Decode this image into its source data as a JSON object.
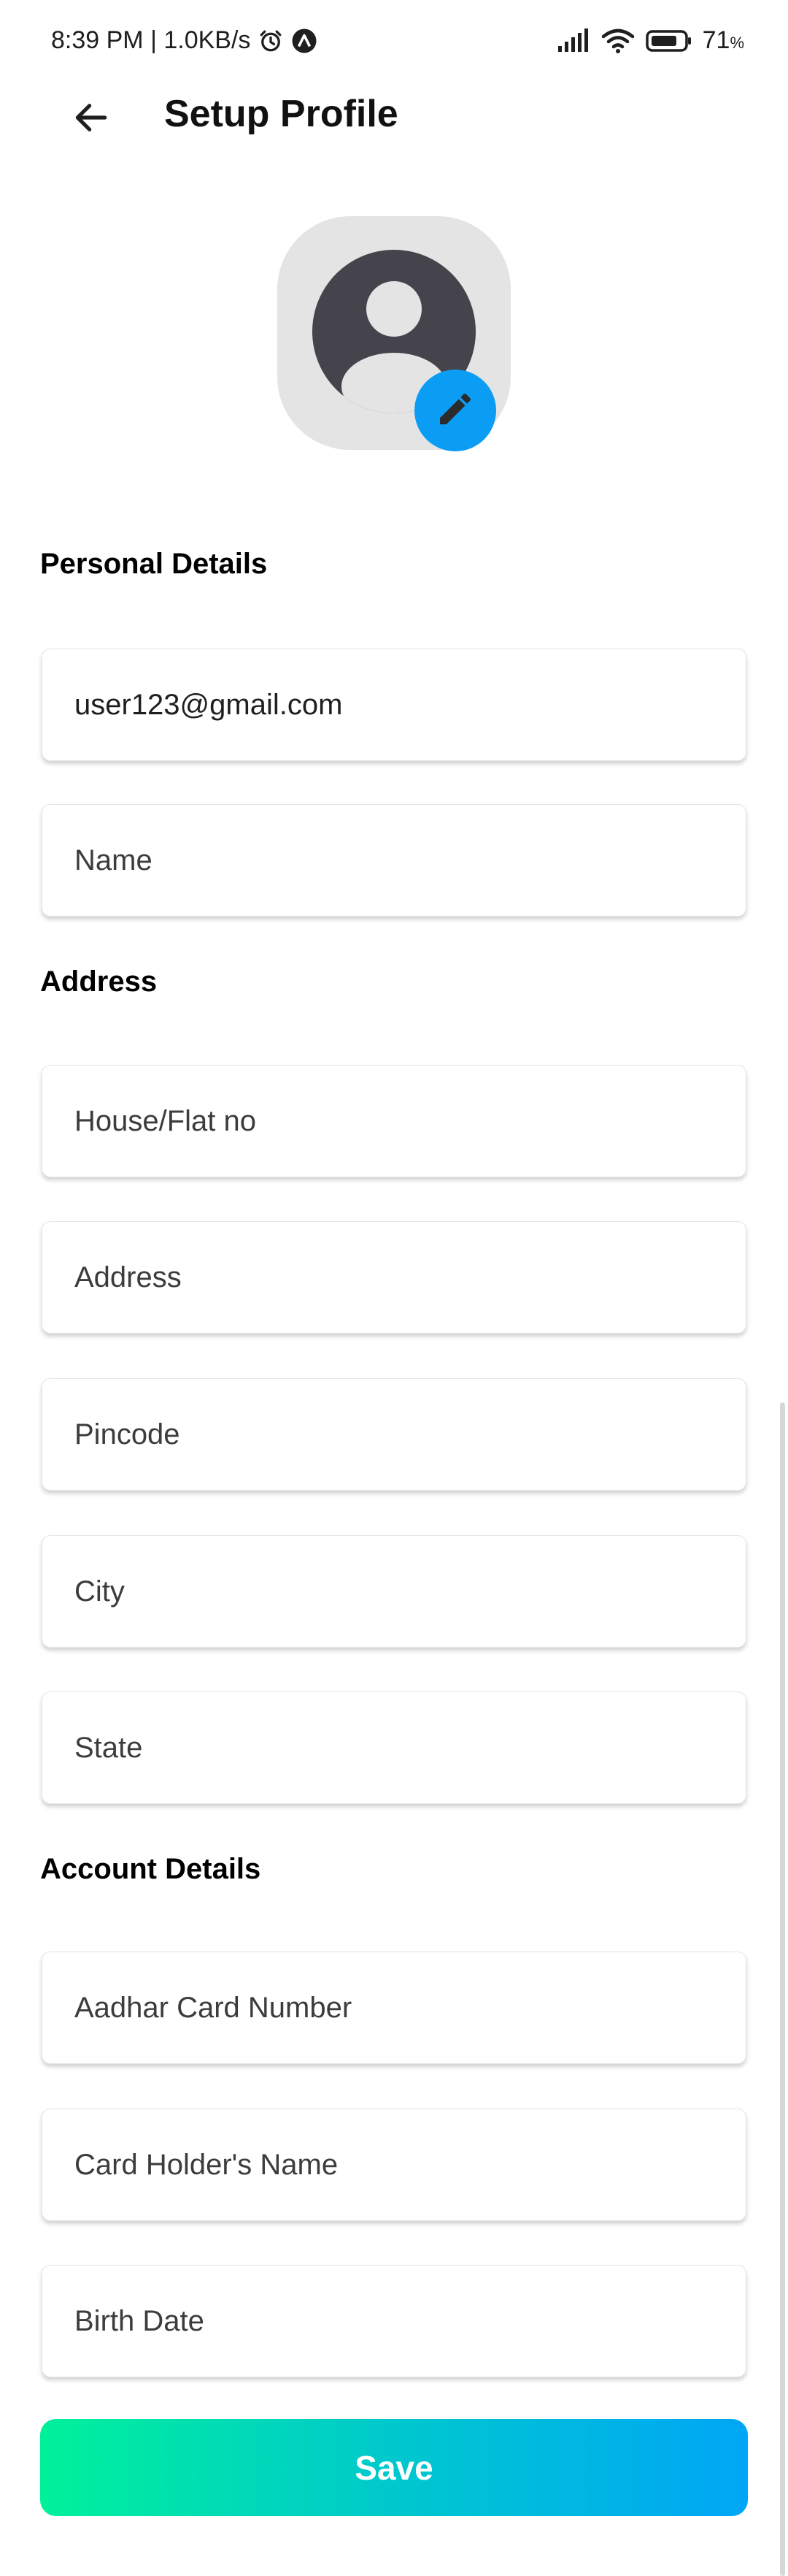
{
  "status_bar": {
    "time_speed": "8:39 PM | 1.0KB/s",
    "battery": "71",
    "battery_suffix": "%"
  },
  "app_bar": {
    "title": "Setup Profile"
  },
  "sections": {
    "personal": "Personal Details",
    "address": "Address",
    "account": "Account Details"
  },
  "fields": {
    "email": {
      "value": "user123@gmail.com",
      "placeholder": ""
    },
    "name": {
      "value": "",
      "placeholder": "Name"
    },
    "house": {
      "value": "",
      "placeholder": "House/Flat no"
    },
    "address": {
      "value": "",
      "placeholder": "Address"
    },
    "pincode": {
      "value": "",
      "placeholder": "Pincode"
    },
    "city": {
      "value": "",
      "placeholder": "City"
    },
    "state": {
      "value": "",
      "placeholder": "State"
    },
    "aadhar": {
      "value": "",
      "placeholder": "Aadhar Card Number"
    },
    "card_holder": {
      "value": "",
      "placeholder": "Card Holder's Name"
    },
    "birth_date": {
      "value": "",
      "placeholder": "Birth Date"
    }
  },
  "save_label": "Save",
  "icons": {
    "back": "arrow-back-icon",
    "avatar": "person-icon",
    "edit": "pencil-icon",
    "alarm": "alarm-icon",
    "app": "app-badge-icon",
    "signal": "signal-icon",
    "wifi": "wifi-icon",
    "battery": "battery-icon"
  },
  "colors": {
    "accent": "#0b9df4",
    "gradient_start": "#00f19a",
    "gradient_end": "#00a6f6",
    "avatar_bg": "#e4e4e4",
    "avatar_fg": "#45434b"
  }
}
